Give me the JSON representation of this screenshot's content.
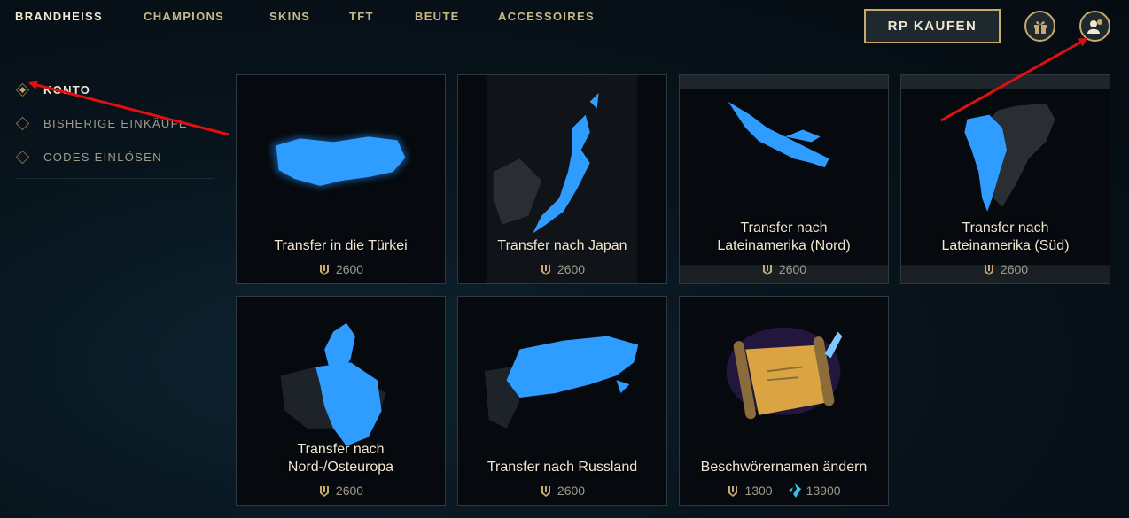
{
  "nav": {
    "items": [
      {
        "label": "BRANDHEISS",
        "active": true
      },
      {
        "label": "CHAMPIONS"
      },
      {
        "label": "SKINS"
      },
      {
        "label": "TFT"
      },
      {
        "label": "BEUTE"
      },
      {
        "label": "ACCESSOIRES"
      }
    ],
    "rp_button": "RP KAUFEN",
    "gift_icon": "gift-icon",
    "account_icon": "account-icon"
  },
  "sidebar": {
    "items": [
      {
        "label": "KONTO",
        "active": true
      },
      {
        "label": "BISHERIGE EINKÄUFE"
      },
      {
        "label": "CODES EINLÖSEN"
      }
    ]
  },
  "cards": [
    {
      "title": "Transfer in die Türkei",
      "price": "2600",
      "currency_icon": "be-icon"
    },
    {
      "title": "Transfer nach Japan",
      "price": "2600",
      "currency_icon": "be-icon"
    },
    {
      "title": "Transfer nach\nLateinamerika (Nord)",
      "price": "2600",
      "currency_icon": "be-icon"
    },
    {
      "title": "Transfer nach\nLateinamerika (Süd)",
      "price": "2600",
      "currency_icon": "be-icon"
    },
    {
      "title": "Transfer nach\nNord-/Osteuropa",
      "price": "2600",
      "currency_icon": "be-icon"
    },
    {
      "title": "Transfer nach Russland",
      "price": "2600",
      "currency_icon": "be-icon"
    },
    {
      "title": "Beschwörernamen ändern",
      "price": "1300",
      "price2": "13900",
      "currency_icon": "be-icon",
      "currency2_icon": "rp-icon"
    }
  ],
  "colors": {
    "gold": "#c8aa6e",
    "map_blue": "#1e8fff",
    "annotation_red": "#e01010"
  }
}
